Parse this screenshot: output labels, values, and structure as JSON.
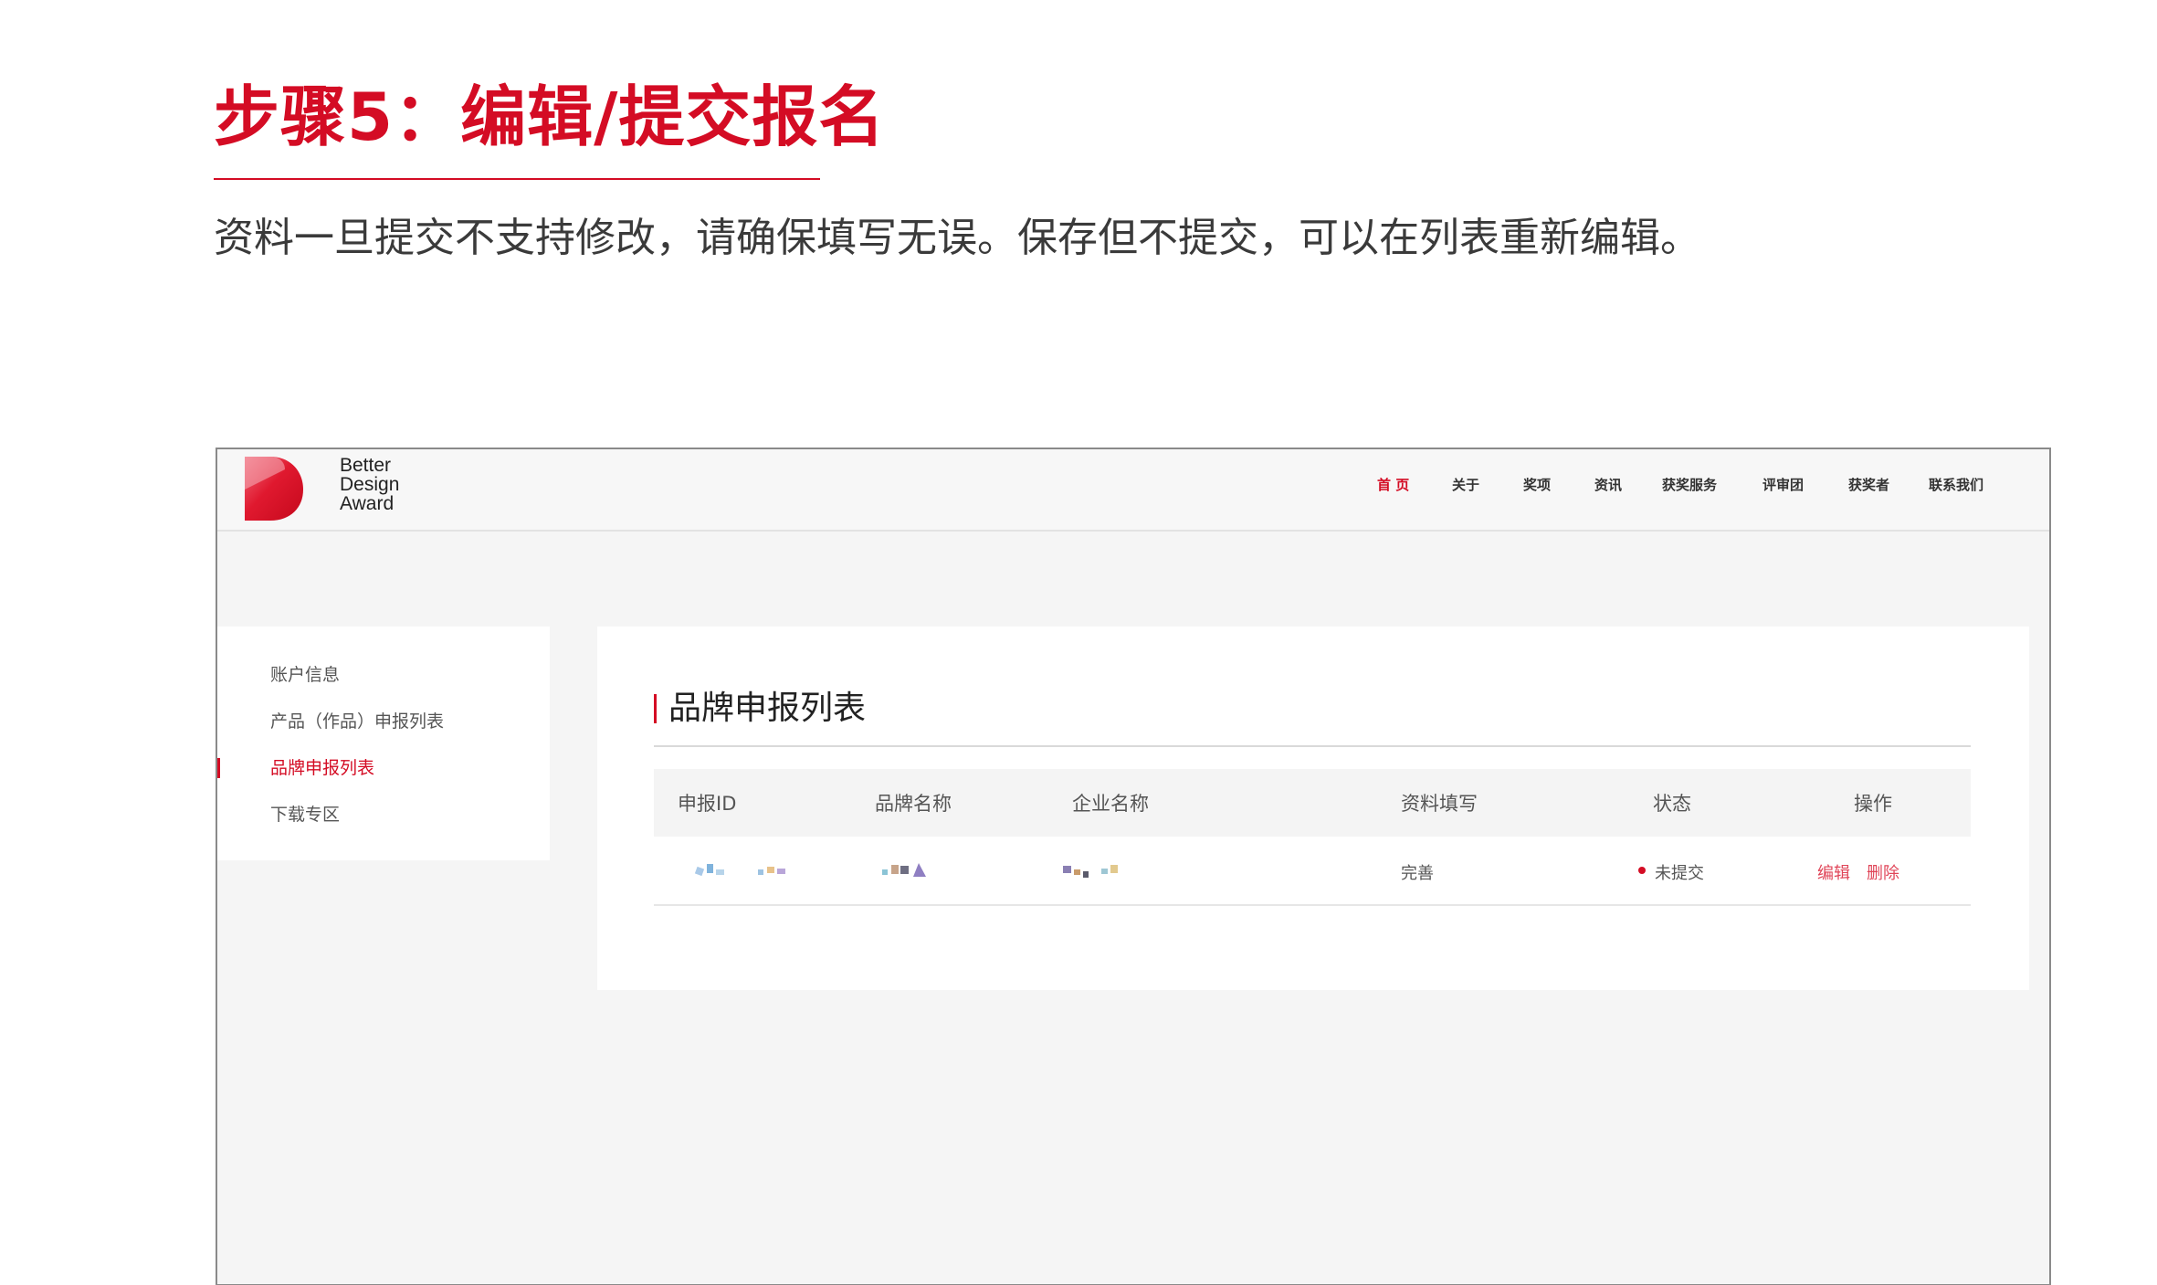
{
  "instruction": {
    "title": "步骤5：编辑/提交报名",
    "description": "资料一旦提交不支持修改，请确保填写无误。保存但不提交，可以在列表重新编辑。"
  },
  "colors": {
    "accent": "#d40c24",
    "frame_bg": "#f5f5f5",
    "panel_bg": "#ffffff"
  },
  "site": {
    "logo": {
      "line1": "Better",
      "line2": "Design",
      "line3": "Award",
      "icon": "bda-logo-mark"
    },
    "nav": [
      {
        "label": "首 页",
        "active": true
      },
      {
        "label": "关于",
        "active": false
      },
      {
        "label": "奖项",
        "active": false
      },
      {
        "label": "资讯",
        "active": false
      },
      {
        "label": "获奖服务",
        "active": false
      },
      {
        "label": "评审团",
        "active": false
      },
      {
        "label": "获奖者",
        "active": false
      },
      {
        "label": "联系我们",
        "active": false
      }
    ]
  },
  "sidebar": {
    "items": [
      {
        "label": "账户信息",
        "active": false
      },
      {
        "label": "产品（作品）申报列表",
        "active": false
      },
      {
        "label": "品牌申报列表",
        "active": true
      },
      {
        "label": "下载专区",
        "active": false
      }
    ]
  },
  "panel": {
    "title": "品牌申报列表",
    "columns": [
      "申报ID",
      "品牌名称",
      "企业名称",
      "资料填写",
      "状态",
      "操作"
    ],
    "rows": [
      {
        "id": "",
        "brand_name": "",
        "company_name": "",
        "completion": "完善",
        "status": "未提交",
        "actions": {
          "edit": "编辑",
          "delete": "删除"
        }
      }
    ]
  }
}
